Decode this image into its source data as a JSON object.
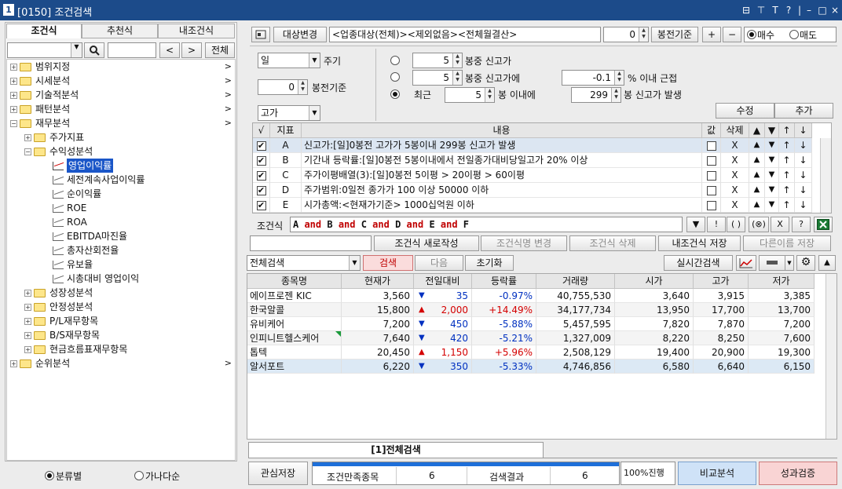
{
  "window": {
    "id": "1",
    "title": "[0150] 조건검색",
    "controls": [
      "⊟",
      "⊤",
      "T",
      "?",
      "|",
      "–",
      "□",
      "×"
    ]
  },
  "left": {
    "tabs": [
      "조건식",
      "추천식",
      "내조건식"
    ],
    "search_btn_label": "전체",
    "nav_prev": "<",
    "nav_next": ">",
    "tree": [
      {
        "label": "범위지정",
        "level": 0,
        "type": "folder",
        "pm": "+",
        "arrow": ">"
      },
      {
        "label": "시세분석",
        "level": 0,
        "type": "folder",
        "pm": "+",
        "arrow": ">"
      },
      {
        "label": "기술적분석",
        "level": 0,
        "type": "folder",
        "pm": "+",
        "arrow": ">"
      },
      {
        "label": "패턴분석",
        "level": 0,
        "type": "folder",
        "pm": "+",
        "arrow": ">"
      },
      {
        "label": "재무분석",
        "level": 0,
        "type": "folder",
        "pm": "−",
        "arrow": ">"
      },
      {
        "label": "주가지표",
        "level": 1,
        "type": "folder",
        "pm": "+"
      },
      {
        "label": "수익성분석",
        "level": 1,
        "type": "folder",
        "pm": "−"
      },
      {
        "label": "영업이익률",
        "level": 2,
        "type": "leaf",
        "selected": true
      },
      {
        "label": "세전계속사업이익률",
        "level": 2,
        "type": "leaf"
      },
      {
        "label": "순이익률",
        "level": 2,
        "type": "leaf"
      },
      {
        "label": "ROE",
        "level": 2,
        "type": "leaf"
      },
      {
        "label": "ROA",
        "level": 2,
        "type": "leaf"
      },
      {
        "label": "EBITDA마진율",
        "level": 2,
        "type": "leaf"
      },
      {
        "label": "총자산회전율",
        "level": 2,
        "type": "leaf"
      },
      {
        "label": "유보율",
        "level": 2,
        "type": "leaf"
      },
      {
        "label": "시총대비 영업이익",
        "level": 2,
        "type": "leaf"
      },
      {
        "label": "성장성분석",
        "level": 1,
        "type": "folder",
        "pm": "+"
      },
      {
        "label": "안정성분석",
        "level": 1,
        "type": "folder",
        "pm": "+"
      },
      {
        "label": "P/L재무항목",
        "level": 1,
        "type": "folder",
        "pm": "+"
      },
      {
        "label": "B/S재무항목",
        "level": 1,
        "type": "folder",
        "pm": "+"
      },
      {
        "label": "현금흐름표재무항목",
        "level": 1,
        "type": "folder",
        "pm": "+"
      },
      {
        "label": "순위분석",
        "level": 0,
        "type": "folder",
        "pm": "+",
        "arrow": ">"
      }
    ],
    "radio_sort": [
      "분류별",
      "가나다순"
    ]
  },
  "top": {
    "target_btn": "대상변경",
    "target_text": "<업종대상(전체)><제외없음><전체월결산>",
    "bong_value": "0",
    "bong_btn": "봉전기준",
    "plus": "+",
    "minus": "−",
    "buy": "매수",
    "sell": "매도"
  },
  "cond": {
    "period_value": "일",
    "period_label": "주기",
    "bong2_value": "0",
    "bong2_label": "봉전기준",
    "price_value": "고가",
    "opt1_value": "5",
    "opt1_label": "봉중 신고가",
    "opt2_value": "5",
    "opt2_label": "봉중 신고가에",
    "opt2_pct_value": "-0.1",
    "opt2_pct_label": "% 이내 근접",
    "opt3_prefix": "최근",
    "opt3_value": "5",
    "opt3_label": "봉 이내에",
    "opt3_value2": "299",
    "opt3_label2": "봉 신고가 발생",
    "edit_btn": "수정",
    "add_btn": "추가"
  },
  "cond_table": {
    "headers": [
      "√",
      "지표",
      "내용",
      "값",
      "삭제",
      "▲",
      "▼",
      "↑",
      "↓"
    ],
    "rows": [
      {
        "key": "A",
        "content": "신고가:[일]0봉전 고가가 5봉이내 299봉 신고가 발생",
        "del": "X",
        "up": "▲",
        "dn": "▼",
        "u": "↑",
        "d": "↓",
        "checked": "✔"
      },
      {
        "key": "B",
        "content": "기간내 등락률:[일]0봉전 5봉이내에서 전일종가대비당일고가 20% 이상",
        "del": "X",
        "up": "▲",
        "dn": "▼",
        "u": "↑",
        "d": "↓",
        "checked": "✔"
      },
      {
        "key": "C",
        "content": "주가이평배열(3):[일]0봉전 5이평 > 20이평 > 60이평",
        "del": "X",
        "up": "▲",
        "dn": "▼",
        "u": "↑",
        "d": "↓",
        "checked": "✔"
      },
      {
        "key": "D",
        "content": "주가범위:0일전 종가가 100 이상 50000 이하",
        "del": "X",
        "up": "▲",
        "dn": "▼",
        "u": "↑",
        "d": "↓",
        "checked": "✔"
      },
      {
        "key": "E",
        "content": "시가총액:<현재가기준> 1000십억원 이하",
        "del": "X",
        "up": "▲",
        "dn": "▼",
        "u": "↑",
        "d": "↓",
        "checked": "✔"
      }
    ]
  },
  "formula": {
    "label": "조건식",
    "tokens": [
      {
        "t": "A",
        "k": false
      },
      {
        "t": " and ",
        "k": true
      },
      {
        "t": "B",
        "k": false
      },
      {
        "t": " and ",
        "k": true
      },
      {
        "t": "C",
        "k": false
      },
      {
        "t": " and ",
        "k": true
      },
      {
        "t": "D",
        "k": false
      },
      {
        "t": " and ",
        "k": true
      },
      {
        "t": "E",
        "k": false
      },
      {
        "t": " and ",
        "k": true
      },
      {
        "t": "F",
        "k": false
      }
    ],
    "tools": [
      "▼",
      "!",
      "( )",
      "(⊗)",
      "X",
      "?"
    ]
  },
  "actions": {
    "new": "조건식 새로작성",
    "rename": "조건식명 변경",
    "delete": "조건식 삭제",
    "save": "내조건식 저장",
    "save_as": "다른이름 저장"
  },
  "search": {
    "scope": "전체검색",
    "search_btn": "검색",
    "next_btn": "다음",
    "reset_btn": "초기화",
    "realtime_btn": "실시간검색"
  },
  "results": {
    "headers": [
      "종목명",
      "현재가",
      "전일대비",
      "등락률",
      "거래량",
      "시가",
      "고가",
      "저가"
    ],
    "rows": [
      {
        "name": "에이프로젠 KIC",
        "price": "3,560",
        "dir": "dn",
        "chg": "35",
        "pct": "-0.97%",
        "vol": "40,755,530",
        "open": "3,640",
        "high": "3,915",
        "low": "3,385",
        "tag": false
      },
      {
        "name": "한국알콜",
        "price": "15,800",
        "dir": "up",
        "chg": "2,000",
        "pct": "+14.49%",
        "vol": "34,177,734",
        "open": "13,950",
        "high": "17,700",
        "low": "13,700",
        "tag": false
      },
      {
        "name": "유비케어",
        "price": "7,200",
        "dir": "dn",
        "chg": "450",
        "pct": "-5.88%",
        "vol": "5,457,595",
        "open": "7,820",
        "high": "7,870",
        "low": "7,200",
        "tag": false
      },
      {
        "name": "인피니트헬스케어",
        "price": "7,640",
        "dir": "dn",
        "chg": "420",
        "pct": "-5.21%",
        "vol": "1,327,009",
        "open": "8,220",
        "high": "8,250",
        "low": "7,600",
        "tag": true
      },
      {
        "name": "톱텍",
        "price": "20,450",
        "dir": "up",
        "chg": "1,150",
        "pct": "+5.96%",
        "vol": "2,508,129",
        "open": "19,400",
        "high": "20,900",
        "low": "19,300",
        "tag": false
      },
      {
        "name": "알서포트",
        "price": "6,220",
        "dir": "dn",
        "chg": "350",
        "pct": "-5.33%",
        "vol": "4,746,856",
        "open": "6,580",
        "high": "6,640",
        "low": "6,150",
        "tag": false
      }
    ]
  },
  "bottom": {
    "tab": "[1]전체검색",
    "interest_btn": "관심저장",
    "matched_label": "조건만족종목",
    "matched_value": "6",
    "result_label": "검색결과",
    "result_value": "6",
    "progress_text": "100%진행",
    "progress": 1.0,
    "compare_btn": "비교분석",
    "verify_btn": "성과검증"
  }
}
